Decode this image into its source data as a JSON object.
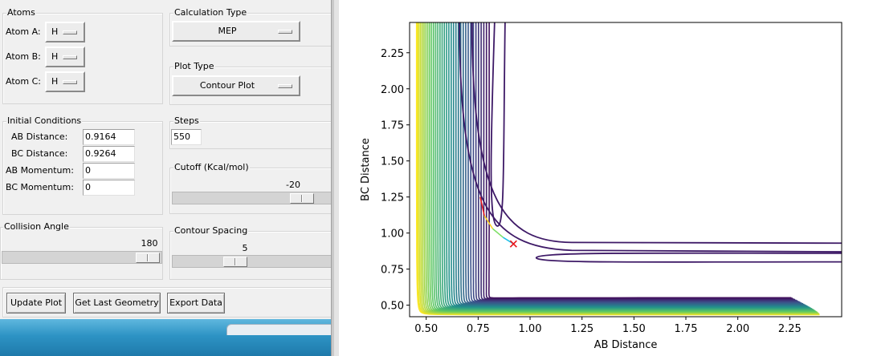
{
  "atoms": {
    "title": "Atoms",
    "a": {
      "label": "Atom A:",
      "value": "H"
    },
    "b": {
      "label": "Atom B:",
      "value": "H"
    },
    "c": {
      "label": "Atom C:",
      "value": "H"
    }
  },
  "calc_type": {
    "title": "Calculation Type",
    "value": "MEP"
  },
  "plot_type": {
    "title": "Plot Type",
    "value": "Contour Plot"
  },
  "initial": {
    "title": "Initial Conditions",
    "ab_distance": {
      "label": "AB Distance:",
      "value": "0.9164"
    },
    "bc_distance": {
      "label": "BC Distance:",
      "value": "0.9264"
    },
    "ab_momentum": {
      "label": "AB Momentum:",
      "value": "0"
    },
    "bc_momentum": {
      "label": "BC Momentum:",
      "value": "0"
    }
  },
  "steps": {
    "title": "Steps",
    "value": "550"
  },
  "cutoff": {
    "title": "Cutoff (Kcal/mol)",
    "value": "-20",
    "fraction": 0.88
  },
  "collision": {
    "title": "Collision Angle",
    "value": "180",
    "fraction": 1.0
  },
  "spacing": {
    "title": "Contour Spacing",
    "value": "5",
    "fraction": 0.38
  },
  "buttons": {
    "update": "Update Plot",
    "geometry": "Get Last Geometry",
    "export": "Export Data"
  },
  "chart_data": {
    "type": "contour",
    "xlabel": "AB Distance",
    "ylabel": "BC Distance",
    "xlim": [
      0.42,
      2.5
    ],
    "ylim": [
      0.42,
      2.46
    ],
    "xticks": [
      "0.50",
      "0.75",
      "1.00",
      "1.25",
      "1.50",
      "1.75",
      "2.00",
      "2.25"
    ],
    "yticks": [
      "0.50",
      "0.75",
      "1.00",
      "1.25",
      "1.50",
      "1.75",
      "2.00",
      "2.25"
    ],
    "colormap": [
      "#440154",
      "#3b528b",
      "#21918c",
      "#5ec962",
      "#fde725"
    ],
    "trajectory": [
      [
        0.76,
        1.25
      ],
      [
        0.78,
        1.12
      ],
      [
        0.82,
        1.03
      ],
      [
        0.87,
        0.97
      ],
      [
        0.92,
        0.925
      ]
    ],
    "end_marker": {
      "x": 0.92,
      "y": 0.925,
      "symbol": "x",
      "color": "#e8151b"
    }
  }
}
